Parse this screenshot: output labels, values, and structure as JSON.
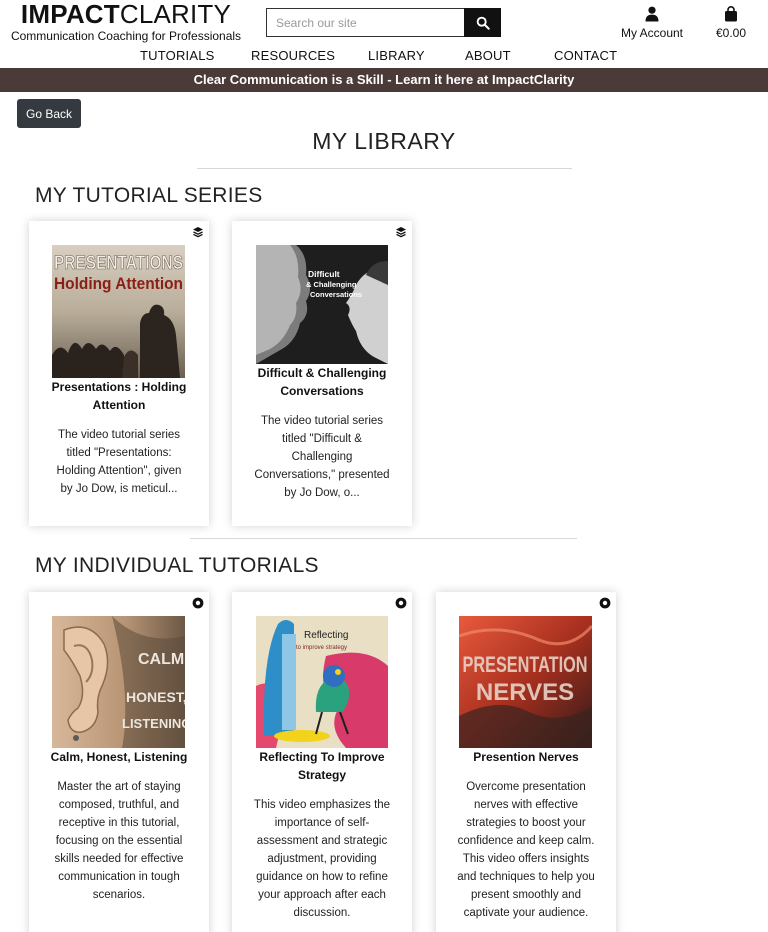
{
  "brand": {
    "name_bold": "IMPACT",
    "name_light": "CLARITY",
    "tagline": "Communication Coaching for Professionals"
  },
  "search": {
    "placeholder": "Search our site"
  },
  "account": {
    "label": "My Account"
  },
  "cart": {
    "total": "€0.00"
  },
  "nav": [
    "TUTORIALS",
    "RESOURCES",
    "LIBRARY",
    "ABOUT",
    "CONTACT"
  ],
  "banner": "Clear Communication is a Skill - Learn it here at ImpactClarity",
  "go_back": "Go Back",
  "page_title": "MY LIBRARY",
  "series_section": {
    "title": "MY TUTORIAL SERIES",
    "cards": [
      {
        "title": "Presentations : Holding Attention",
        "description": "The video tutorial series titled \"Presentations: Holding Attention\", given by Jo Dow, is meticul...",
        "image_text": [
          "PRESENTATIONS",
          "Holding Attention"
        ],
        "badge_icon": "layers-icon"
      },
      {
        "title": "Difficult & Challenging Conversations",
        "description": "The video tutorial series titled \"Difficult & Challenging Conversations,\" presented by Jo Dow, o...",
        "image_text": [
          "Difficult",
          "& Challenging",
          "Conversations"
        ],
        "badge_icon": "layers-icon"
      }
    ]
  },
  "individual_section": {
    "title": "MY INDIVIDUAL TUTORIALS",
    "cards": [
      {
        "title": "Calm, Honest, Listening",
        "description": "Master the art of staying composed, truthful, and receptive in this tutorial, focusing on the essential skills needed for effective communication in tough scenarios.",
        "image_text": [
          "CALM",
          "HONEST,",
          "LISTENING"
        ],
        "badge_icon": "record-icon"
      },
      {
        "title": "Reflecting To Improve Strategy",
        "description": "This video emphasizes the importance of self-assessment and strategic adjustment, providing guidance on how to refine your approach after each discussion.",
        "image_text": [
          "Reflecting",
          "to improve strategy"
        ],
        "badge_icon": "record-icon"
      },
      {
        "title": "Presention Nerves",
        "description": "Overcome presentation nerves with effective strategies to boost your confidence and keep calm. This video offers insights and techniques to help you present smoothly and captivate your audience.",
        "image_text": [
          "PRESENTATION",
          "NERVES"
        ],
        "badge_icon": "record-icon"
      }
    ]
  },
  "colors": {
    "banner_bg": "#4a3b39",
    "button_bg": "#343a40",
    "search_button_bg": "#111111"
  }
}
